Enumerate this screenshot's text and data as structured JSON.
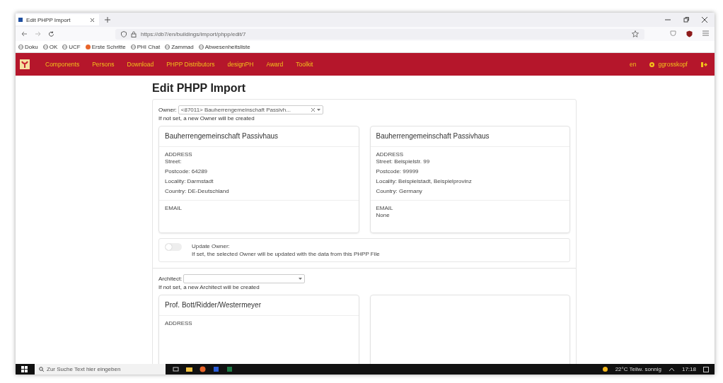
{
  "browser": {
    "tab_title": "Edit PHPP Import",
    "url": "https://db7/en/buildings/import/phpp/edit/7",
    "bookmarks": [
      "Doku",
      "OK",
      "UCF",
      "Erste Schritte",
      "PHI Chat",
      "Zammad",
      "Abwesenheitsliste"
    ]
  },
  "navbar": {
    "items": [
      "Components",
      "Persons",
      "Download",
      "PHPP Distributors",
      "designPH",
      "Award",
      "Toolkit"
    ],
    "language": "en",
    "user": "ggrosskopf"
  },
  "page_title": "Edit PHPP Import",
  "sections": [
    {
      "label": "Owner:",
      "value": "<87011> Bauherrengemeinschaft Passivh...",
      "hint": "If not set, a new Owner will be created",
      "cards": [
        {
          "kind": "person",
          "title": "Bauherrengemeinschaft Passivhaus",
          "address_label": "ADDRESS",
          "lines": [
            "Street:",
            "Postcode: 64289",
            "Locality: Darmstadt",
            "Country: DE-Deutschland"
          ],
          "email_label": "EMAIL"
        },
        {
          "kind": "person",
          "title": "Bauherrengemeinschaft Passivhaus",
          "address_label": "ADDRESS",
          "lines": [
            "Street: Beispielstr. 99",
            "Postcode: 99999",
            "Locality: Beispielstadt, Beispielprovinz",
            "Country: Germany"
          ],
          "email_label": "EMAIL",
          "email": "None"
        }
      ],
      "toggle": {
        "label": "Update Owner:",
        "description": "If set, the selected Owner will be updated with the data from this PHPP File",
        "on": false
      }
    },
    {
      "label": "Architect:",
      "hint": "If not set, a new Architect will be created",
      "cards": [
        {
          "kind": "person",
          "title": "Prof. Bott/Ridder/Westermeyer",
          "address_label": "ADDRESS"
        },
        {
          "kind": "blank"
        }
      ]
    }
  ],
  "taskbar": {
    "search_placeholder": "Zur Suche Text hier eingeben",
    "weather": "22°C Teilw. sonnig",
    "time": "17:18"
  }
}
